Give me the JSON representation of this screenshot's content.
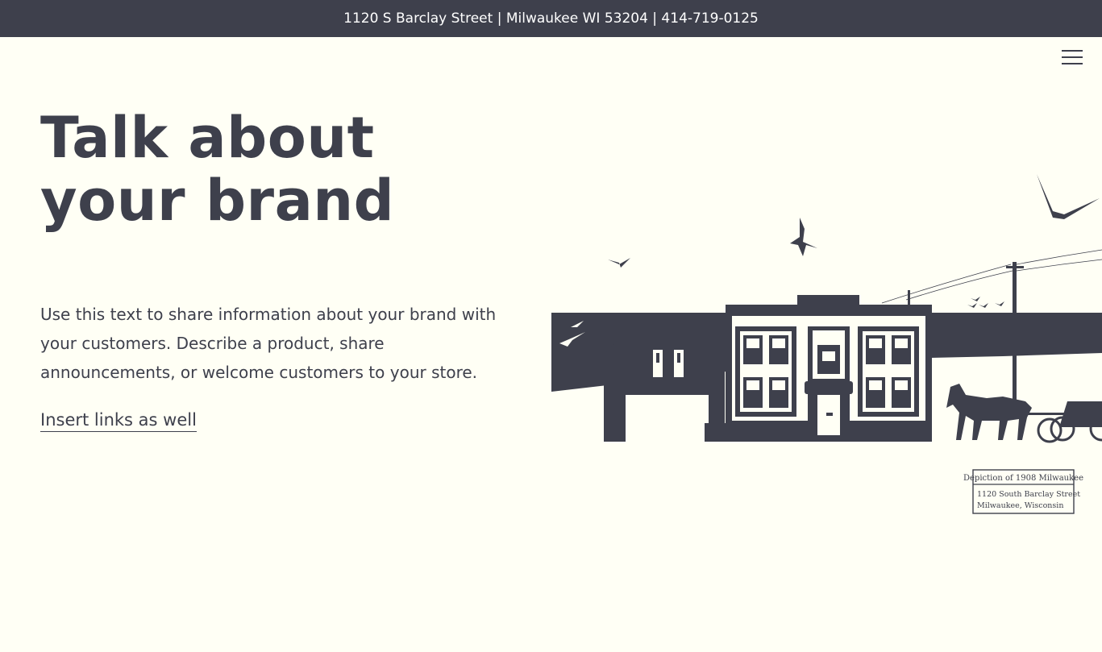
{
  "topbar": {
    "text": "1120 S Barclay Street | Milwaukee WI 53204 | 414-719-0125"
  },
  "header": {
    "menu_icon": "hamburger-menu-icon"
  },
  "main": {
    "headline": "Talk about your brand",
    "body": "Use this text to share information about your brand with your customers. Describe a product, share announcements, or welcome customers to your store.",
    "link_label": "Insert links as well"
  },
  "illustration": {
    "caption_title": "Depiction of 1908 Milwaukee",
    "caption_line1": "1120 South Barclay Street",
    "caption_line2": "Milwaukee, Wisconsin"
  },
  "colors": {
    "primary": "#3e404c",
    "background": "#fffff5"
  }
}
